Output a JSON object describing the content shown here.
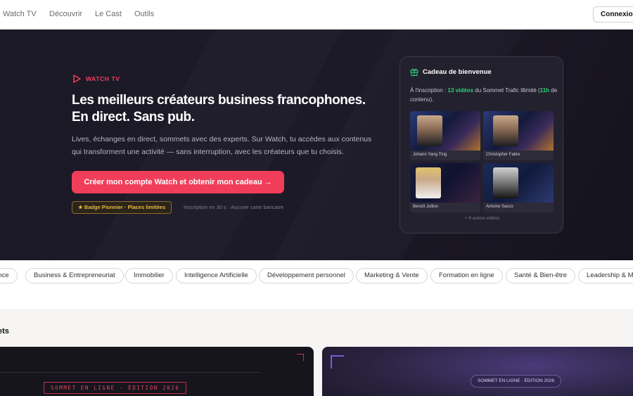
{
  "nav": {
    "items": [
      "Watch TV",
      "Découvrir",
      "Le Cast",
      "Outils"
    ],
    "login_label": "Connexion"
  },
  "hero": {
    "eyebrow": "WATCH TV",
    "title_line1": "Les meilleurs créateurs business francophones.",
    "title_line2": "En direct. Sans pub.",
    "lead": "Lives, échanges en direct, sommets avec des experts. Sur Watch, tu accèdes aux contenus qui transforment une activité — sans interruption, avec les créateurs que tu choisis.",
    "cta_label": "Créer mon compte Watch et obtenir mon cadeau →",
    "badge_label": "★ Badge Pionnier · Places limitées",
    "badge_note": "Inscription en 30 s · Aucune carte bancaire"
  },
  "gift": {
    "title": "Cadeau de bienvenue",
    "desc_prefix": "À l'inscription : ",
    "desc_count": "13 vidéos",
    "desc_mid": " du Sommet Trafic Illimité (",
    "desc_hours": "11h",
    "desc_suffix": " de contenu).",
    "videos": [
      {
        "name": "Johann Yang-Ting"
      },
      {
        "name": "Christopher Fabre"
      },
      {
        "name": "Benoît Jullion"
      },
      {
        "name": "Antoine Sacco"
      }
    ],
    "more": "+ 9 autres vidéos"
  },
  "categories": [
    "ance",
    "Business & Entrepreneuriat",
    "Immobilier",
    "Intelligence Artificielle",
    "Développement personnel",
    "Marketing & Vente",
    "Formation en ligne",
    "Santé & Bien-être",
    "Leadership & Ma"
  ],
  "section": {
    "title": "ets",
    "card1_tag": "SOMMET EN LIGNE · ÉDITION 2026",
    "card2_tag": "SOMMET EN LIGNE · ÉDITION 2026"
  },
  "colors": {
    "accent": "#f03e5a",
    "hero_bg": "#1c1926",
    "gift_highlight": "#2ed47a",
    "badge_gold": "#e9b949"
  }
}
